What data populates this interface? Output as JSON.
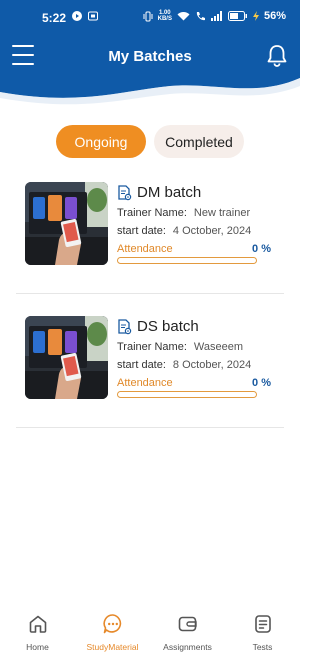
{
  "status_bar": {
    "time": "5:22",
    "net_speed_value": "1.00",
    "net_speed_unit": "KB/S",
    "battery_pct": "56%"
  },
  "header": {
    "title": "My Batches"
  },
  "tabs": [
    {
      "label": "Ongoing",
      "active": true
    },
    {
      "label": "Completed",
      "active": false
    }
  ],
  "batches": [
    {
      "title": "DM batch",
      "trainer_label": "Trainer Name:",
      "trainer_value": "New trainer",
      "start_label": "start date:",
      "start_value": "4 October, 2024",
      "attendance_label": "Attendance",
      "attendance_value": "0 %",
      "attendance_fraction": 0
    },
    {
      "title": "DS batch",
      "trainer_label": "Trainer Name:",
      "trainer_value": "Waseeem",
      "start_label": "start date:",
      "start_value": "8 October, 2024",
      "attendance_label": "Attendance",
      "attendance_value": "0 %",
      "attendance_fraction": 0
    }
  ],
  "bottom_nav": [
    {
      "label": "Home",
      "icon": "home-icon",
      "active": false
    },
    {
      "label": "StudyMaterial",
      "icon": "chat-bubble-icon",
      "active": true
    },
    {
      "label": "Assignments",
      "icon": "wallet-icon",
      "active": false
    },
    {
      "label": "Tests",
      "icon": "document-list-icon",
      "active": false
    }
  ],
  "colors": {
    "header_blue": "#0f5aa8",
    "accent_orange": "#ef8e22",
    "attendance_blue": "#1a5aa0"
  }
}
